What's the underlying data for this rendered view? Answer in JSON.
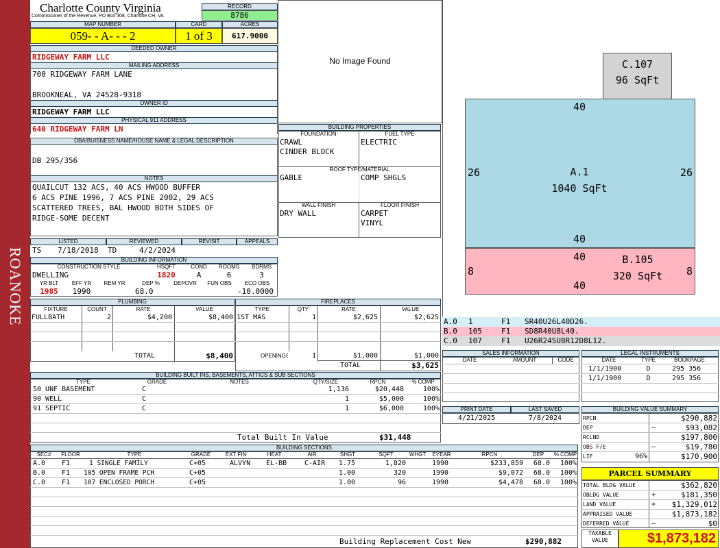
{
  "sidebar": {
    "label": "ROANOKE"
  },
  "header": {
    "county": "Charlotte County Virginia",
    "office": "Commissioner of the Revenue, PO Box 308, Charlotte CH, VA",
    "record_label": "RECORD",
    "record": "8786",
    "map_number_label": "MAP NUMBER",
    "map_number": "059- - A- - - 2",
    "card_label": "CARD",
    "card": "1 of 3",
    "acres_label": "ACRES",
    "acres": "617.9000"
  },
  "owner": {
    "deeded_label": "DEEDED OWNER",
    "deeded": "RIDGEWAY FARM LLC",
    "mailing_label": "MAILING ADDRESS",
    "address1": "700 RIDGEWAY FARM LANE",
    "address2": "BROOKNEAL, VA 24528-9318",
    "owner_id_label": "OWNER ID",
    "owner_id": "RIDGEWAY FARM LLC",
    "physical_label": "PHYSICAL 911 ADDRESS",
    "physical": "640 RIDGEWAY FARM LN"
  },
  "legal": {
    "label": "DBA/BUISNESS NAME/HOUSE NAME & LEGAL DESCRIPTION",
    "text": "DB 295/356"
  },
  "notes": {
    "label": "NOTES",
    "lines": [
      "QUAILCUT 132 ACS, 40 ACS HWOOD BUFFER",
      "6 ACS PINE 1996, 7 ACS PINE 2002, 29 ACS",
      "SCATTERED TREES, BAL HWOOD BOTH SIDES OF",
      "RIDGE-SOME DECENT"
    ]
  },
  "dates": {
    "listed_label": "LISTED",
    "reviewed_label": "REVIEWED",
    "revisit_label": "REVISIT",
    "appeals_label": "APPEALS",
    "listed_by": "TS",
    "listed": "7/18/2018",
    "reviewed_by": "TD",
    "reviewed": "4/2/2024"
  },
  "building_info": {
    "label": "BUILDING INFORMATION",
    "style_label": "CONSTRUCTION STYLE",
    "hsqft_label": "HSQFT",
    "cond_label": "COND",
    "rooms_label": "ROOMS",
    "bdrms_label": "BDRMS",
    "style": "DWELLING",
    "hsqft": "1820",
    "cond": "A",
    "rooms": "6",
    "bdrms": "3",
    "yrblt_label": "YR BLT",
    "effyr_label": "EFF YR",
    "remyr_label": "REM YR",
    "dep_label": "DEP %",
    "depovr_label": "DEPOVR",
    "funobs_label": "FUN OBS",
    "ecoobs_label": "ECO OBS",
    "yrblt": "1985",
    "effyr": "1990",
    "dep": "68.0",
    "ecoobs": "-10.0000"
  },
  "image": {
    "text": "No Image Found"
  },
  "building_props": {
    "label": "BUILDING PROPERTIES",
    "foundation_label": "FOUNDATION",
    "fuel_label": "FUEL TYPE",
    "foundation1": "CRAWL",
    "foundation2": "CINDER BLOCK",
    "fuel": "ELECTRIC",
    "roof_label": "ROOF TYPE/MATERIAL",
    "roof1": "GABLE",
    "roof2": "COMP SHGLS",
    "wall_label": "WALL FINISH",
    "floor_label": "FLOOR FINISH",
    "wall": "DRY WALL",
    "floor1": "CARPET",
    "floor2": "VINYL"
  },
  "sketch": {
    "c_label": "C.107",
    "c_area": "96 SqFt",
    "a_top": "40",
    "a_left": "26",
    "a_right": "26",
    "a_bottom": "40",
    "a_label": "A.1",
    "a_area": "1040 SqFt",
    "b_top": "40",
    "b_left": "8",
    "b_right": "8",
    "b_bottom": "40",
    "b_label": "B.105",
    "b_area": "320 SqFt",
    "colors": {
      "a": "#add8e6",
      "b": "#ffb6c1",
      "c": "#d3d3d3"
    }
  },
  "vectors": [
    {
      "sec": "A.0",
      "code": "1",
      "floor": "F1",
      "vec": "SR40U26L40D26."
    },
    {
      "sec": "B.0",
      "code": "105",
      "floor": "F1",
      "vec": "SD8R40U8L40."
    },
    {
      "sec": "C.0",
      "code": "107",
      "floor": "F1",
      "vec": "U26R24SU8R12D8L12."
    }
  ],
  "plumbing": {
    "label": "PLUMBING",
    "fixture_label": "FIXTURE",
    "count_label": "COUNT",
    "rate_label": "RATE",
    "value_label": "VALUE",
    "rows": [
      {
        "fixture": "FULLBATH",
        "count": "2",
        "rate": "$4,200",
        "value": "$8,400"
      }
    ],
    "total_label": "TOTAL",
    "total": "$8,400"
  },
  "fireplaces": {
    "label": "FIREPLACES",
    "type_label": "TYPE",
    "qty_label": "QTY",
    "rate_label": "RATE",
    "value_label": "VALUE",
    "rows": [
      {
        "type": "1ST MAS",
        "qty": "1",
        "rate": "$2,625",
        "value": "$2,625"
      }
    ],
    "openings_label": "OPENINGS",
    "openings_qty": "1",
    "openings_rate": "$1,000",
    "openings_value": "$1,000",
    "total_label": "TOTAL",
    "total": "$3,625"
  },
  "sales": {
    "label": "SALES INFORMATION",
    "date_label": "DATE",
    "amount_label": "AMOUNT",
    "code_label": "CODE"
  },
  "legal_inst": {
    "label": "LEGAL INSTRUMENTS",
    "date_label": "DATE",
    "type_label": "TYPE",
    "book_label": "BOOKPAGE",
    "rows": [
      {
        "date": "1/1/1900",
        "type": "D",
        "book": "295 356"
      },
      {
        "date": "1/1/1900",
        "type": "D",
        "book": "295 356"
      }
    ]
  },
  "built_ins": {
    "label": "BUILDING BUILT INS, BASEMENTS, ATTICS & SUB SECTIONS",
    "type_label": "TYPE",
    "grade_label": "GRADE",
    "notes_label": "NOTES",
    "qty_label": "QTY/SIZE",
    "rpcn_label": "RPCN",
    "comp_label": "% COMP",
    "rows": [
      {
        "type": "50 UNF BASEMENT",
        "grade": "C",
        "qty": "1,136",
        "rpcn": "$20,448",
        "comp": "100%"
      },
      {
        "type": "90 WELL",
        "grade": "C",
        "qty": "1",
        "rpcn": "$5,000",
        "comp": "100%"
      },
      {
        "type": "91 SEPTIC",
        "grade": "C",
        "qty": "1",
        "rpcn": "$6,000",
        "comp": "100%"
      }
    ],
    "total_label": "Total Built In Value",
    "total": "$31,448"
  },
  "print": {
    "print_label": "PRINT DATE",
    "saved_label": "LAST SAVED",
    "print": "4/21/2025",
    "saved": "7/8/2024"
  },
  "value_summary": {
    "label": "BUILDING VALUE SUMMARY",
    "rows": [
      {
        "label": "RPCN",
        "sign": "",
        "value": "$290,882"
      },
      {
        "label": "DEP",
        "sign": "–",
        "value": "$93,082"
      },
      {
        "label": "RCLND",
        "sign": "",
        "value": "$197,800"
      },
      {
        "label": "OBS F/E",
        "sign": "–",
        "value": "$19,780"
      },
      {
        "label": "LIF",
        "pct": "96%",
        "sign": "",
        "value": "$170,900"
      }
    ]
  },
  "sections": {
    "label": "BUILDING SECTIONS",
    "headers": [
      "SEC#",
      "FLOOR",
      "TYPE",
      "GRADE",
      "EXT FIN",
      "HEAT",
      "AIR",
      "SHGT",
      "SQFT",
      "WHGT",
      "EYEAR",
      "RPCN",
      "DEP",
      "% COMP"
    ],
    "rows": [
      {
        "sec": "A.0",
        "floor": "F1",
        "type": "1 SINGLE FAMILY",
        "grade": "C+05",
        "ext": "ALVYN",
        "heat": "EL-BB",
        "air": "C-AIR",
        "shgt": "1.75",
        "sqft": "1,820",
        "eyear": "1990",
        "rpcn": "$233,859",
        "dep": "68.0",
        "comp": "100%"
      },
      {
        "sec": "B.0",
        "floor": "F1",
        "type": "105 OPEN FRAME PCH",
        "grade": "C+05",
        "ext": "",
        "heat": "",
        "air": "",
        "shgt": "1.00",
        "sqft": "320",
        "eyear": "1990",
        "rpcn": "$9,072",
        "dep": "68.0",
        "comp": "100%"
      },
      {
        "sec": "C.0",
        "floor": "F1",
        "type": "107 ENCLOSED PORCH",
        "grade": "C+05",
        "ext": "",
        "heat": "",
        "air": "",
        "shgt": "1.00",
        "sqft": "96",
        "eyear": "1990",
        "rpcn": "$4,478",
        "dep": "68.0",
        "comp": "100%"
      }
    ],
    "rcn_label": "Building Replacement Cost New",
    "rcn": "$290,882"
  },
  "parcel": {
    "label": "PARCEL SUMMARY",
    "rows": [
      {
        "label": "TOTAL BLDG VALUE",
        "sign": "",
        "value": "$362,820"
      },
      {
        "label": "OBLDG VALUE",
        "sign": "+",
        "value": "$181,350"
      },
      {
        "label": "LAND VALUE",
        "sign": "+",
        "value": "$1,329,012"
      },
      {
        "label": "APPRAISED VALUE",
        "sign": "",
        "value": "$1,873,182"
      },
      {
        "label": "DEFERRED VALUE",
        "sign": "–",
        "value": "$0"
      }
    ],
    "taxable_label1": "TAXABLE",
    "taxable_label2": "VALUE",
    "taxable": "$1,873,182"
  }
}
